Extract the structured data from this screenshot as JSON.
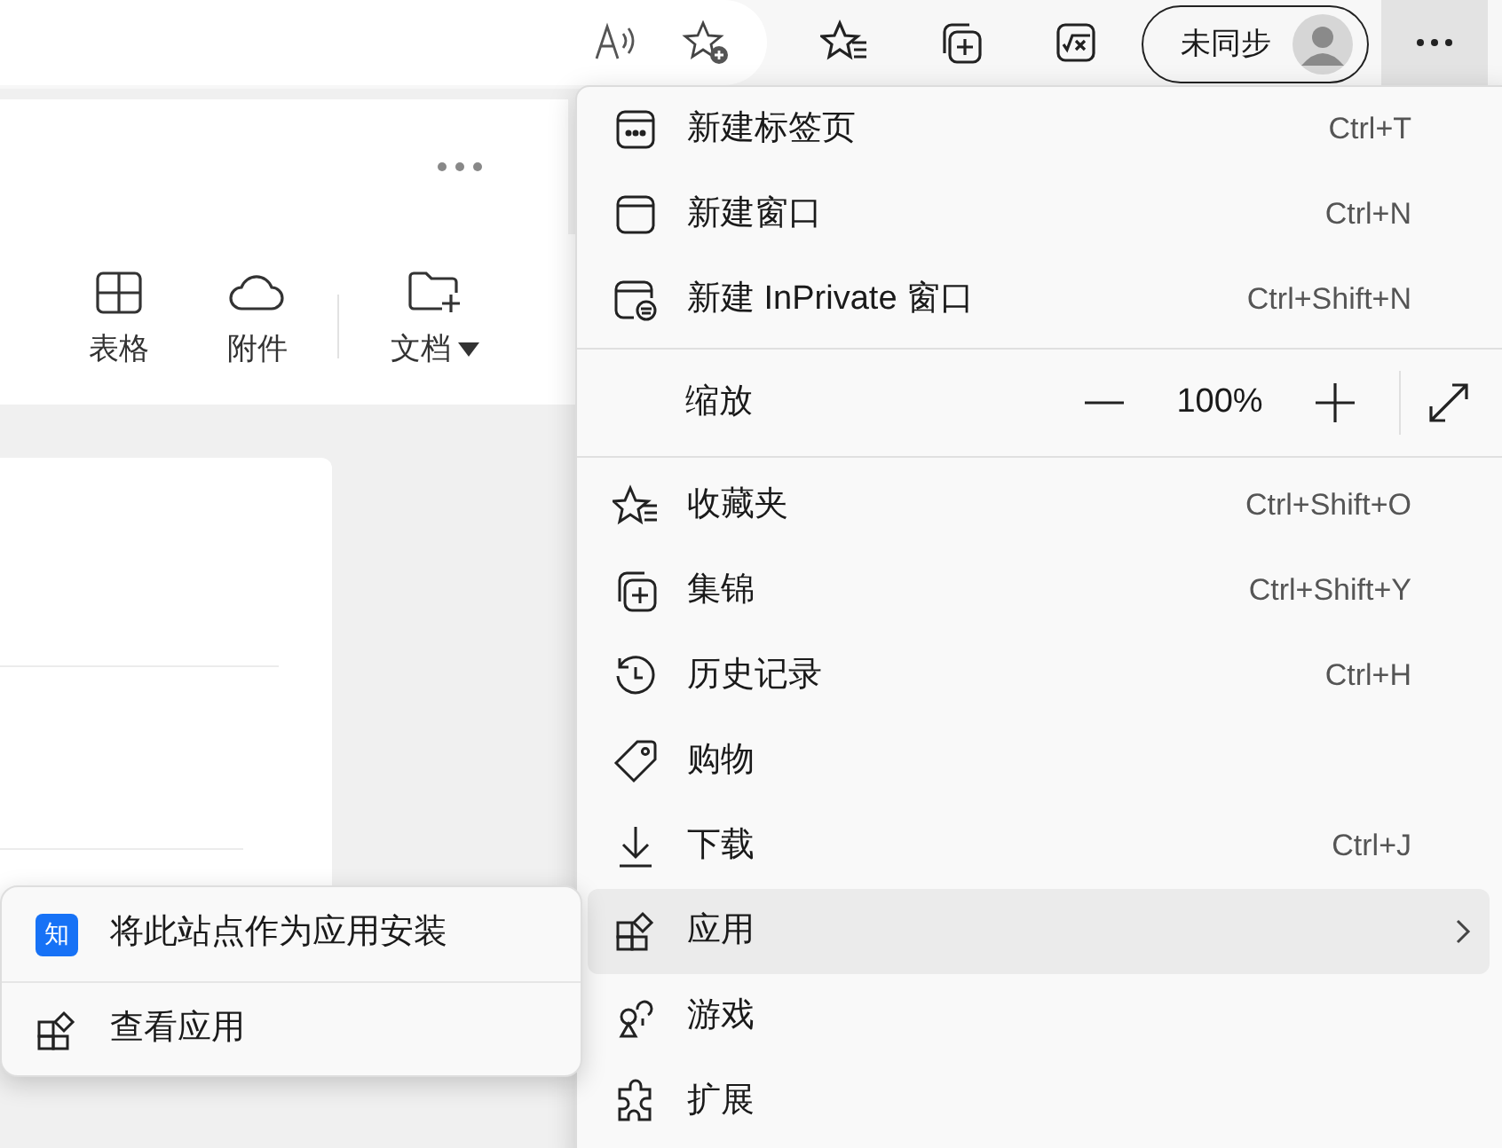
{
  "toolbar": {
    "sync_button": {
      "label": "未同步"
    }
  },
  "page": {
    "ribbon": [
      {
        "label": "表格",
        "kind": "table",
        "dropdown": false
      },
      {
        "label": "附件",
        "kind": "cloud",
        "dropdown": false
      },
      {
        "label": "文档",
        "kind": "folder",
        "dropdown": true
      }
    ]
  },
  "menu": {
    "items": [
      {
        "kind": "item",
        "label": "新建标签页",
        "shortcut": "Ctrl+T",
        "selected": false,
        "submenu": false
      },
      {
        "kind": "item",
        "label": "新建窗口",
        "shortcut": "Ctrl+N",
        "selected": false,
        "submenu": false
      },
      {
        "kind": "item",
        "label": "新建 InPrivate 窗口",
        "shortcut": "Ctrl+Shift+N",
        "selected": false,
        "submenu": false
      },
      {
        "kind": "separator"
      },
      {
        "kind": "zoom",
        "label": "缩放",
        "value": "100%"
      },
      {
        "kind": "separator"
      },
      {
        "kind": "item",
        "label": "收藏夹",
        "shortcut": "Ctrl+Shift+O",
        "selected": false,
        "submenu": false
      },
      {
        "kind": "item",
        "label": "集锦",
        "shortcut": "Ctrl+Shift+Y",
        "selected": false,
        "submenu": false
      },
      {
        "kind": "item",
        "label": "历史记录",
        "shortcut": "Ctrl+H",
        "selected": false,
        "submenu": false
      },
      {
        "kind": "item",
        "label": "购物",
        "selected": false,
        "submenu": false
      },
      {
        "kind": "item",
        "label": "下载",
        "shortcut": "Ctrl+J",
        "selected": false,
        "submenu": false
      },
      {
        "kind": "item",
        "label": "应用",
        "selected": true,
        "submenu": true
      },
      {
        "kind": "item",
        "label": "游戏",
        "selected": false,
        "submenu": false
      },
      {
        "kind": "item",
        "label": "扩展",
        "selected": false,
        "submenu": false
      }
    ]
  },
  "submenu": {
    "items": [
      {
        "label": "将此站点作为应用安装",
        "badge": "知"
      },
      {
        "label": "查看应用"
      }
    ]
  }
}
